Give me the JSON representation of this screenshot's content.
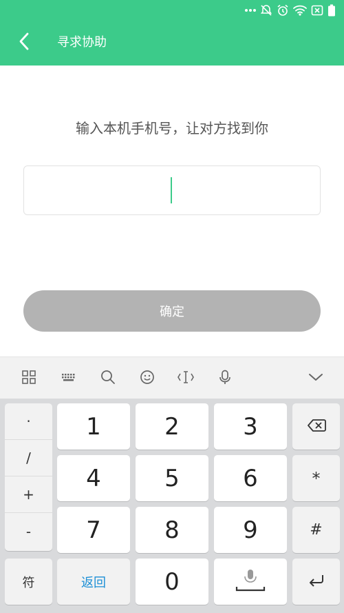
{
  "status_bar": {
    "icons": [
      "more-dots-icon",
      "silent-icon",
      "alarm-icon",
      "wifi-icon",
      "no-sim-icon",
      "battery-icon"
    ]
  },
  "header": {
    "title": "寻求协助",
    "back_icon": "chevron-left-icon"
  },
  "main": {
    "prompt": "输入本机手机号，让对方找到你",
    "phone_input_value": "",
    "confirm_label": "确定"
  },
  "keyboard": {
    "toolbar_icons": [
      "grid-icon",
      "keyboard-icon",
      "search-icon",
      "emoji-icon",
      "cursor-icon",
      "mic-icon",
      "collapse-icon"
    ],
    "symbols": [
      "·",
      "/",
      "+",
      "-"
    ],
    "digits": [
      "1",
      "2",
      "3",
      "4",
      "5",
      "6",
      "7",
      "8",
      "9",
      "0"
    ],
    "star": "*",
    "hash": "#",
    "fu_label": "符",
    "back_label": "返回"
  },
  "colors": {
    "accent": "#3ccb8a",
    "button_disabled": "#b3b3b3",
    "keyboard_bg": "#d9dadc",
    "link_blue": "#1b8fd6"
  }
}
